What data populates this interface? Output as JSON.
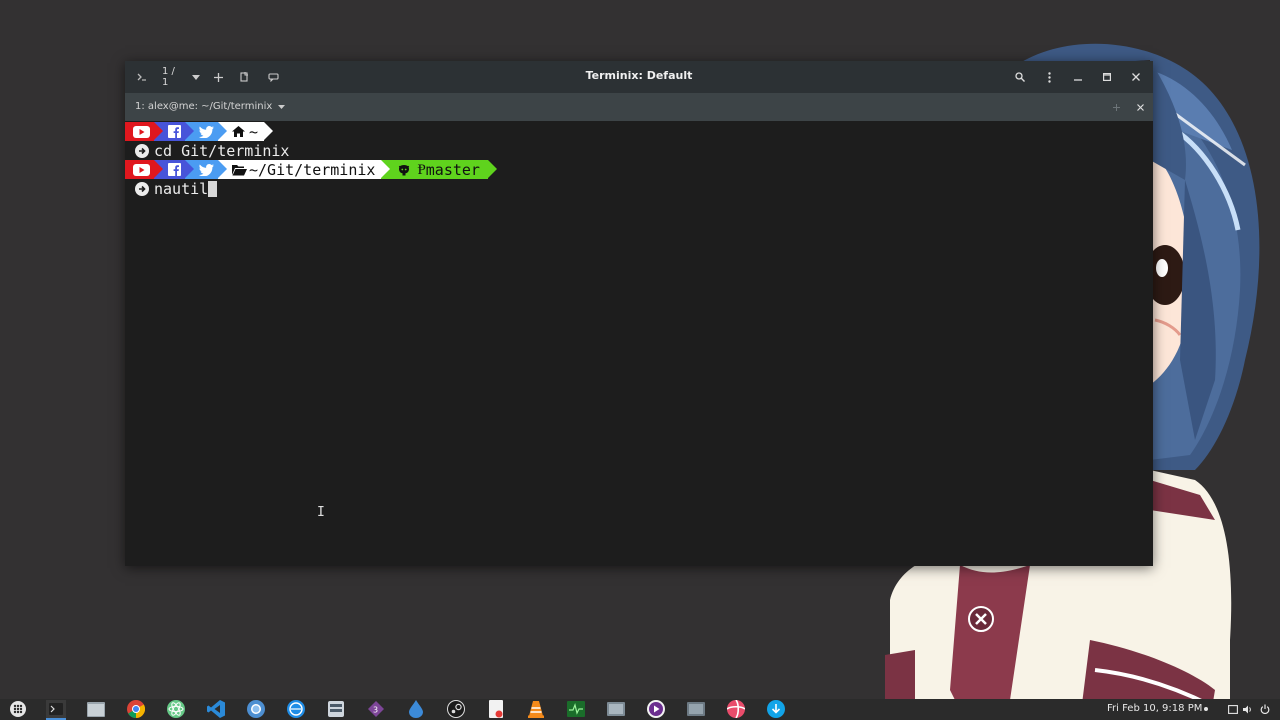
{
  "window": {
    "title": "Terminix: Default",
    "session_counter": "1 / 1",
    "tab_label": "1: alex@me: ~/Git/terminix"
  },
  "terminal": {
    "line1": {
      "segments": [
        "youtube-icon",
        "facebook-icon",
        "twitter-icon",
        "home-icon"
      ],
      "path": "~"
    },
    "line2": {
      "command": "cd Git/terminix"
    },
    "line3": {
      "segments": [
        "youtube-icon",
        "facebook-icon",
        "twitter-icon",
        "folder-icon",
        "github-icon"
      ],
      "path": "~/Git/terminix",
      "branch": "master"
    },
    "line4": {
      "command": "nautil"
    }
  },
  "taskbar": {
    "clock": "Fri Feb 10,  9:18 PM",
    "apps": [
      "apps-grid-icon",
      "terminal-icon",
      "files-icon",
      "chrome-icon",
      "atom-icon",
      "vscode-icon",
      "chromium-icon",
      "browser-icon",
      "server-icon",
      "tor-icon",
      "drop-icon",
      "steam-icon",
      "text-editor-icon",
      "vlc-icon",
      "system-monitor-icon",
      "screenshot-icon",
      "music-icon",
      "screen-icon",
      "candy-icon",
      "download-icon"
    ]
  },
  "colors": {
    "youtube": "#e0171e",
    "facebook": "#4754d9",
    "twitter": "#4b9cf2",
    "path": "#ffffff",
    "git": "#5fd31d",
    "titlebar": "#2c3134",
    "tabbar": "#3d4447",
    "terminal_bg": "#1d1d1d"
  }
}
